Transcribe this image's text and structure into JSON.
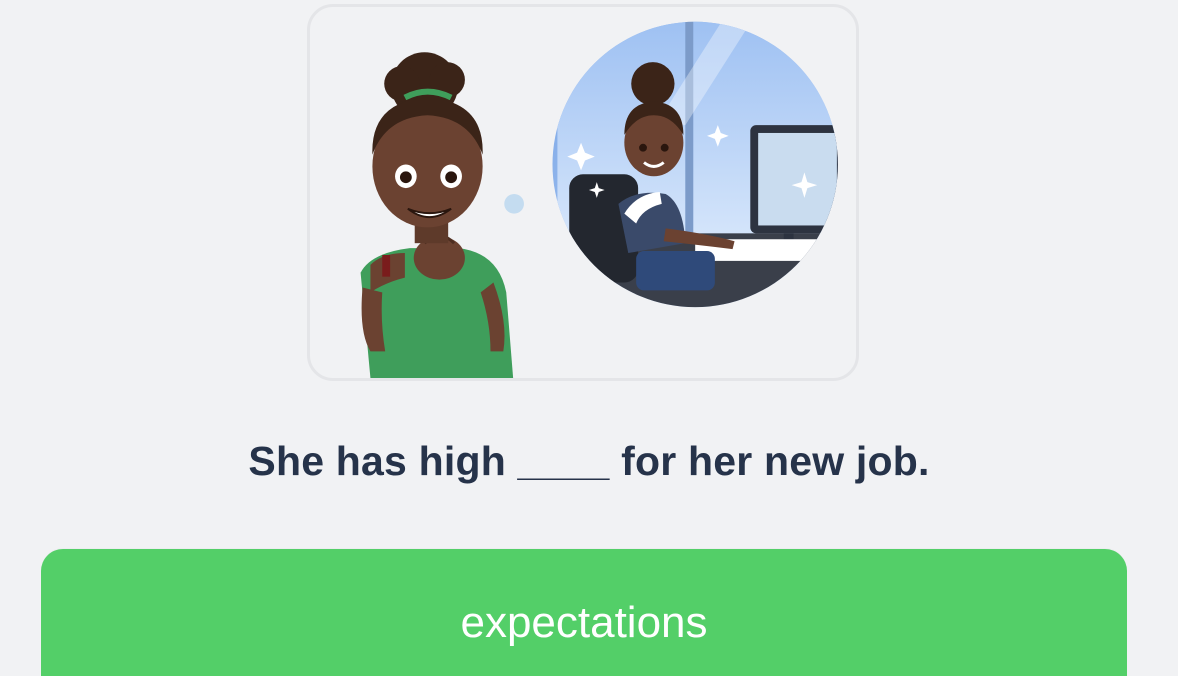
{
  "quiz": {
    "sentence": "She has high ____ for her new job.",
    "answer_option": "expectations",
    "illustration_label": "woman-dreaming-of-office-job-illustration"
  },
  "colors": {
    "background": "#f1f2f4",
    "sentence_text": "#26334a",
    "answer_button": "#53cf68",
    "answer_text": "#ffffff",
    "card_border": "#e4e5e8"
  }
}
